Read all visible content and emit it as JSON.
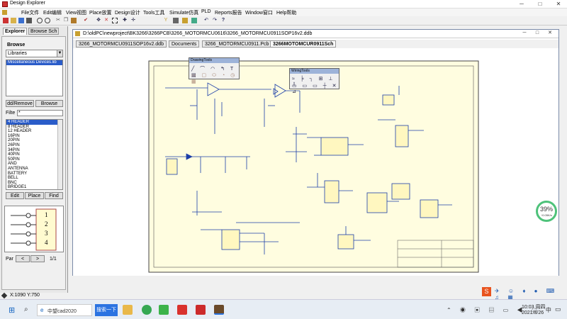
{
  "window": {
    "title": "Design Explorer",
    "min_label": "─",
    "max_label": "□",
    "close_label": "✕"
  },
  "menu": [
    "File文件",
    "Edit编辑",
    "View视图",
    "Place放置",
    "Design设计",
    "Tools工具",
    "Simulate仿真",
    "PLD",
    "Reports报告",
    "Window窗口",
    "Help帮助"
  ],
  "toolbar_icons": [
    "new-icon",
    "open-icon",
    "save-icon",
    "print-icon",
    "zoom-in-icon",
    "zoom-out-icon",
    "cut-icon",
    "copy-icon",
    "paste-icon",
    "select-icon",
    "move-icon",
    "cross-icon",
    "undo-icon",
    "redo-icon",
    "help-icon"
  ],
  "explorer": {
    "tab_explorer": "Explorer",
    "tab_browse": "Browse Sch",
    "browse_label": "Browse",
    "browse_select": "Libraries",
    "libraries": [
      "Miscellaneous Devices.lib"
    ],
    "add_remove": "dd/Remove",
    "browse_button": "Browse",
    "filter_label": "Filte",
    "filter_value": "*",
    "components": [
      "4 HEADER",
      "8 HEADER",
      "12 HEADER",
      "16PIN",
      "20PIN",
      "26PIN",
      "34PIN",
      "40PIN",
      "50PIN",
      "AND",
      "ANTENNA",
      "BATTERY",
      "BELL",
      "BNC",
      "BRIDGE1"
    ],
    "edit_button": "Edit",
    "place_button": "Place",
    "find_button": "Find",
    "preview_pins": [
      "1",
      "2",
      "3",
      "4"
    ],
    "part_label": "Par",
    "part_prev": "<",
    "part_next": ">",
    "part_count": "1/1"
  },
  "document": {
    "path": "D:\\oldPC\\newproject\\BK3266\\3266PCB\\3266_MOTORMCU0616\\3266_MOTORMCU0911SOP16v2.ddb",
    "tabs": [
      "3266_MOTORMCU0911SOP16v2.ddb",
      "Documents",
      "3266_MOTORMCU0911.Pcb",
      "3266MOTOMCUR0911Sch"
    ],
    "active_tab": 3
  },
  "drawing_tools": {
    "title": "DrawingTools"
  },
  "wiring_tools": {
    "title": "WiringTools"
  },
  "status": {
    "coords": "X:1090 Y:750"
  },
  "perf": {
    "value": "39%",
    "sub": "↑0.05K/s"
  },
  "taskbar": {
    "app_label": "中望cad2020",
    "search_label": "搜索一下",
    "time": "10:03 周四",
    "date": "2021/8/26"
  },
  "colors": {
    "accent": "#2a5cc9",
    "sheet": "#fffde0",
    "wire": "#1c3fa8"
  }
}
